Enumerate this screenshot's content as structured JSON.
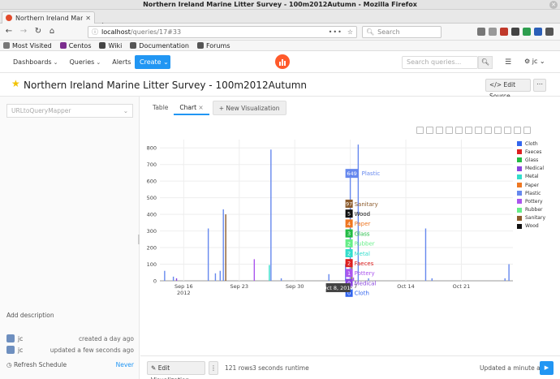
{
  "window": {
    "title": "Northern Ireland Marine Litter Survey - 100m2012Autumn - Mozilla Firefox"
  },
  "tab": {
    "title": "Northern Ireland Marine"
  },
  "url": {
    "host": "localhost",
    "path": "/queries/17#33",
    "dots": "•••"
  },
  "search": {
    "placeholder": "Search"
  },
  "bookmarks": [
    "Most Visited",
    "Centos",
    "Wiki",
    "Documentation",
    "Forums"
  ],
  "appnav": {
    "dashboards": "Dashboards",
    "queries": "Queries",
    "alerts": "Alerts",
    "create": "Create",
    "search_placeholder": "Search queries...",
    "user": "jc"
  },
  "query": {
    "title": "Northern Ireland Marine Litter Survey - 100m2012Autumn",
    "edit_source": "Edit Source",
    "more": "⋯"
  },
  "left": {
    "datasource": "URLtoQueryMapper",
    "add_description": "Add description",
    "created_by": "jc",
    "created": "created a day ago",
    "updated_by": "jc",
    "updated": "updated a few seconds ago",
    "refresh": "Refresh Schedule",
    "never": "Never"
  },
  "viz_tabs": {
    "table": "Table",
    "chart": "Chart",
    "new": "+ New Visualization"
  },
  "footer": {
    "edit_viz": "Edit Visualization",
    "rows": "121 rows",
    "runtime": "3 seconds runtime",
    "updated": "Updated a minute ago"
  },
  "chart_data": {
    "type": "bar",
    "ylim": [
      0,
      850
    ],
    "yticks": [
      0,
      100,
      200,
      300,
      400,
      500,
      600,
      700,
      800
    ],
    "xticks": [
      {
        "label": "Sep 16",
        "sub": "2012",
        "day": 16
      },
      {
        "label": "Sep 23",
        "sub": "",
        "day": 23
      },
      {
        "label": "Sep 30",
        "sub": "",
        "day": 30
      },
      {
        "label": "Oct 7",
        "sub": "",
        "day": 37
      },
      {
        "label": "Oct 14",
        "sub": "",
        "day": 44
      },
      {
        "label": "Oct 21",
        "sub": "",
        "day": 51
      }
    ],
    "xrange": [
      13.0,
      57.5
    ],
    "series": [
      {
        "name": "Cloth",
        "color": "#3366ee"
      },
      {
        "name": "Faeces",
        "color": "#dd1f1f"
      },
      {
        "name": "Glass",
        "color": "#22bb44"
      },
      {
        "name": "Medical",
        "color": "#8844dd"
      },
      {
        "name": "Metal",
        "color": "#33ddcc"
      },
      {
        "name": "Paper",
        "color": "#ee7722"
      },
      {
        "name": "Plastic",
        "color": "#6688ee"
      },
      {
        "name": "Pottery",
        "color": "#aa55ee"
      },
      {
        "name": "Rubber",
        "color": "#66ee88"
      },
      {
        "name": "Sanitary",
        "color": "#8b5a2b"
      },
      {
        "name": "Wood",
        "color": "#111111"
      }
    ],
    "bars": [
      {
        "day": 13.6,
        "series": "Plastic",
        "value": 60
      },
      {
        "day": 14.7,
        "series": "Plastic",
        "value": 25
      },
      {
        "day": 15.1,
        "series": "Medical",
        "value": 15
      },
      {
        "day": 19.1,
        "series": "Plastic",
        "value": 315
      },
      {
        "day": 20.0,
        "series": "Plastic",
        "value": 45
      },
      {
        "day": 20.6,
        "series": "Plastic",
        "value": 60
      },
      {
        "day": 21.0,
        "series": "Plastic",
        "value": 430
      },
      {
        "day": 21.3,
        "series": "Sanitary",
        "value": 400
      },
      {
        "day": 24.9,
        "series": "Pottery",
        "value": 130
      },
      {
        "day": 26.8,
        "series": "Metal",
        "value": 95
      },
      {
        "day": 27.0,
        "series": "Plastic",
        "value": 790
      },
      {
        "day": 28.3,
        "series": "Plastic",
        "value": 15
      },
      {
        "day": 34.3,
        "series": "Plastic",
        "value": 40
      },
      {
        "day": 36.4,
        "series": "Plastic",
        "value": 100
      },
      {
        "day": 37.0,
        "series": "Plastic",
        "value": 649
      },
      {
        "day": 37.2,
        "series": "Sanitary",
        "value": 97
      },
      {
        "day": 37.4,
        "series": "Pottery",
        "value": 20
      },
      {
        "day": 38.0,
        "series": "Plastic",
        "value": 820
      },
      {
        "day": 39.3,
        "series": "Plastic",
        "value": 15
      },
      {
        "day": 46.5,
        "series": "Plastic",
        "value": 315
      },
      {
        "day": 47.3,
        "series": "Plastic",
        "value": 15
      },
      {
        "day": 56.5,
        "series": "Plastic",
        "value": 15
      },
      {
        "day": 57.0,
        "series": "Plastic",
        "value": 100
      }
    ],
    "hover": {
      "day": 37.0,
      "x_label": "Oct 8, 2012",
      "items": [
        {
          "series": "Plastic",
          "value": 649
        },
        {
          "series": "Sanitary",
          "value": 97
        },
        {
          "series": "Wood",
          "value": 5
        },
        {
          "series": "Paper",
          "value": 4
        },
        {
          "series": "Glass",
          "value": 3
        },
        {
          "series": "Rubber",
          "value": 2
        },
        {
          "series": "Metal",
          "value": 2
        },
        {
          "series": "Faeces",
          "value": 2
        },
        {
          "series": "Pottery",
          "value": 1
        },
        {
          "series": "Medical",
          "value": 0
        },
        {
          "series": "Cloth",
          "value": 0
        }
      ]
    }
  }
}
